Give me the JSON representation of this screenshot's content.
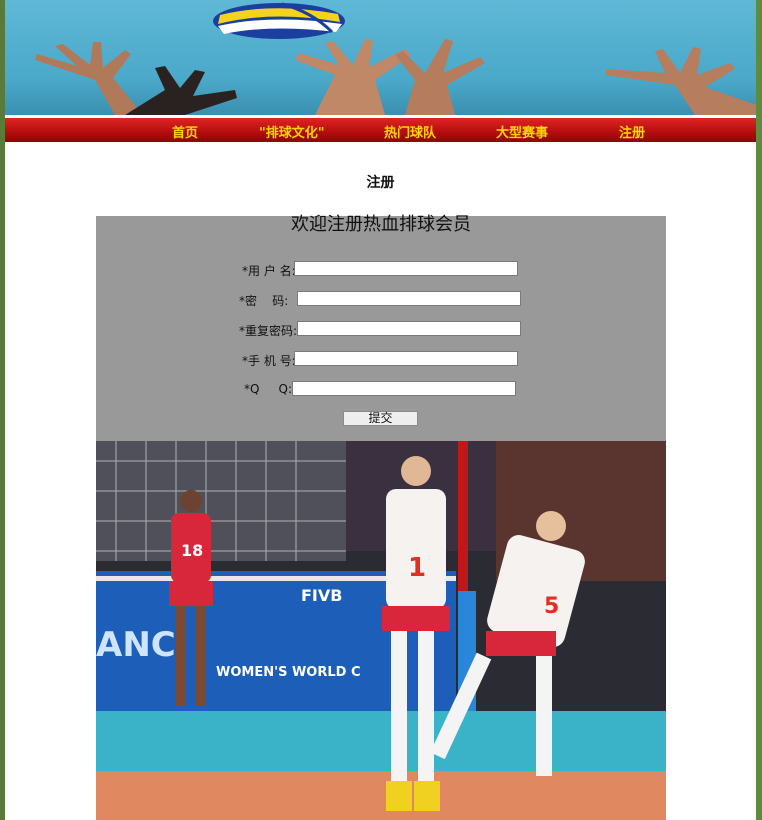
{
  "nav": {
    "items": [
      {
        "label": "首页"
      },
      {
        "label": "\"排球文化\""
      },
      {
        "label": "热门球队"
      },
      {
        "label": "大型赛事"
      },
      {
        "label": "注册"
      }
    ]
  },
  "page_title": "注册",
  "form": {
    "heading": "欢迎注册热血排球会员",
    "fields": [
      {
        "label": "*用 户 名:",
        "value": ""
      },
      {
        "label": "*密    码:",
        "value": ""
      },
      {
        "label": "*重复密码:",
        "value": ""
      },
      {
        "label": "*手 机 号:",
        "value": ""
      },
      {
        "label": "*Q     Q:",
        "value": ""
      }
    ],
    "submit_label": "提交"
  },
  "photo": {
    "jersey_left": "18",
    "jersey_center": "1",
    "jersey_right": "5",
    "board_brand": "FIVB",
    "board_text": "WOMEN'S WORLD C",
    "board_big": "ANC"
  },
  "colors": {
    "nav_bg": "#c01010",
    "nav_text": "#ffd800",
    "panel_bg": "#999999",
    "banner_sky": "#4aa8c9"
  }
}
